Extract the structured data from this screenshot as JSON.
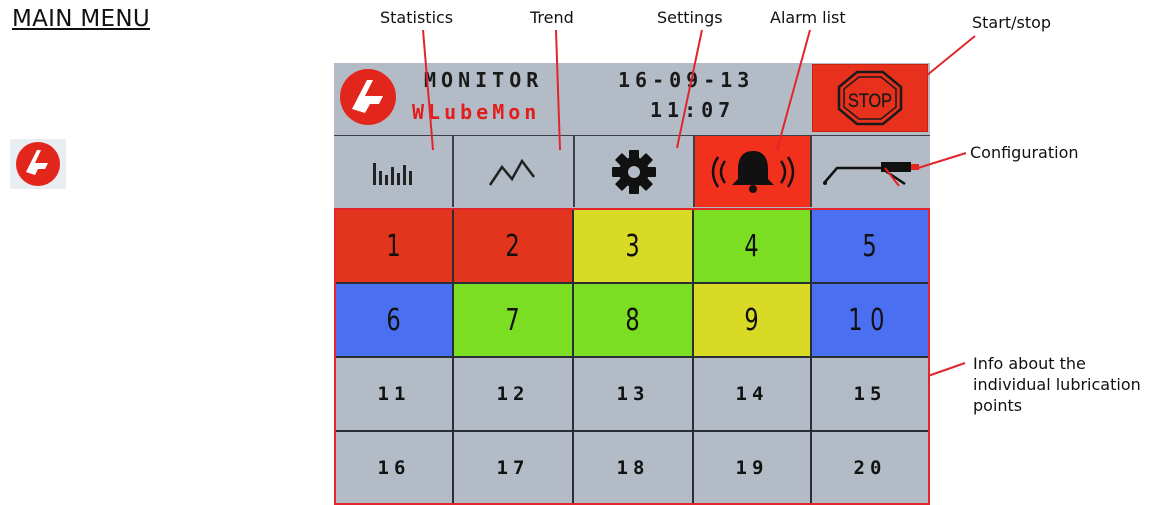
{
  "page": {
    "title": "MAIN MENU"
  },
  "annotations": {
    "statistics": "Statistics",
    "trend": "Trend",
    "settings": "Settings",
    "alarm_list": "Alarm list",
    "start_stop": "Start/stop",
    "configuration": "Configuration",
    "info_line1": "Info about the",
    "info_line2": "individual lubrication",
    "info_line3": "points"
  },
  "device": {
    "header": {
      "product_line1": "MONITOR",
      "product_line2": "WLubeMon",
      "date": "16-09-13",
      "time": "11:07",
      "stop_label": "STOP"
    },
    "toolbar": [
      {
        "icon": "statistics-icon"
      },
      {
        "icon": "trend-icon"
      },
      {
        "icon": "settings-gear-icon"
      },
      {
        "icon": "alarm-bell-icon"
      },
      {
        "icon": "lubrication-gun-icon"
      }
    ],
    "points": [
      {
        "label": "1",
        "status_color": "#e3341e"
      },
      {
        "label": "2",
        "status_color": "#e3341e"
      },
      {
        "label": "3",
        "status_color": "#d9da25"
      },
      {
        "label": "4",
        "status_color": "#7cde22"
      },
      {
        "label": "5",
        "status_color": "#4a6ff0"
      },
      {
        "label": "6",
        "status_color": "#4a6ff0"
      },
      {
        "label": "7",
        "status_color": "#7cde22"
      },
      {
        "label": "8",
        "status_color": "#7cde22"
      },
      {
        "label": "9",
        "status_color": "#d9da25"
      },
      {
        "label": "10",
        "status_color": "#4a6ff0"
      },
      {
        "label": "11",
        "status_color": "#b3bcc6"
      },
      {
        "label": "12",
        "status_color": "#b3bcc6"
      },
      {
        "label": "13",
        "status_color": "#b3bcc6"
      },
      {
        "label": "14",
        "status_color": "#b3bcc6"
      },
      {
        "label": "15",
        "status_color": "#b3bcc6"
      },
      {
        "label": "16",
        "status_color": "#b3bcc6"
      },
      {
        "label": "17",
        "status_color": "#b3bcc6"
      },
      {
        "label": "18",
        "status_color": "#b3bcc6"
      },
      {
        "label": "19",
        "status_color": "#b3bcc6"
      },
      {
        "label": "20",
        "status_color": "#b3bcc6"
      }
    ]
  }
}
